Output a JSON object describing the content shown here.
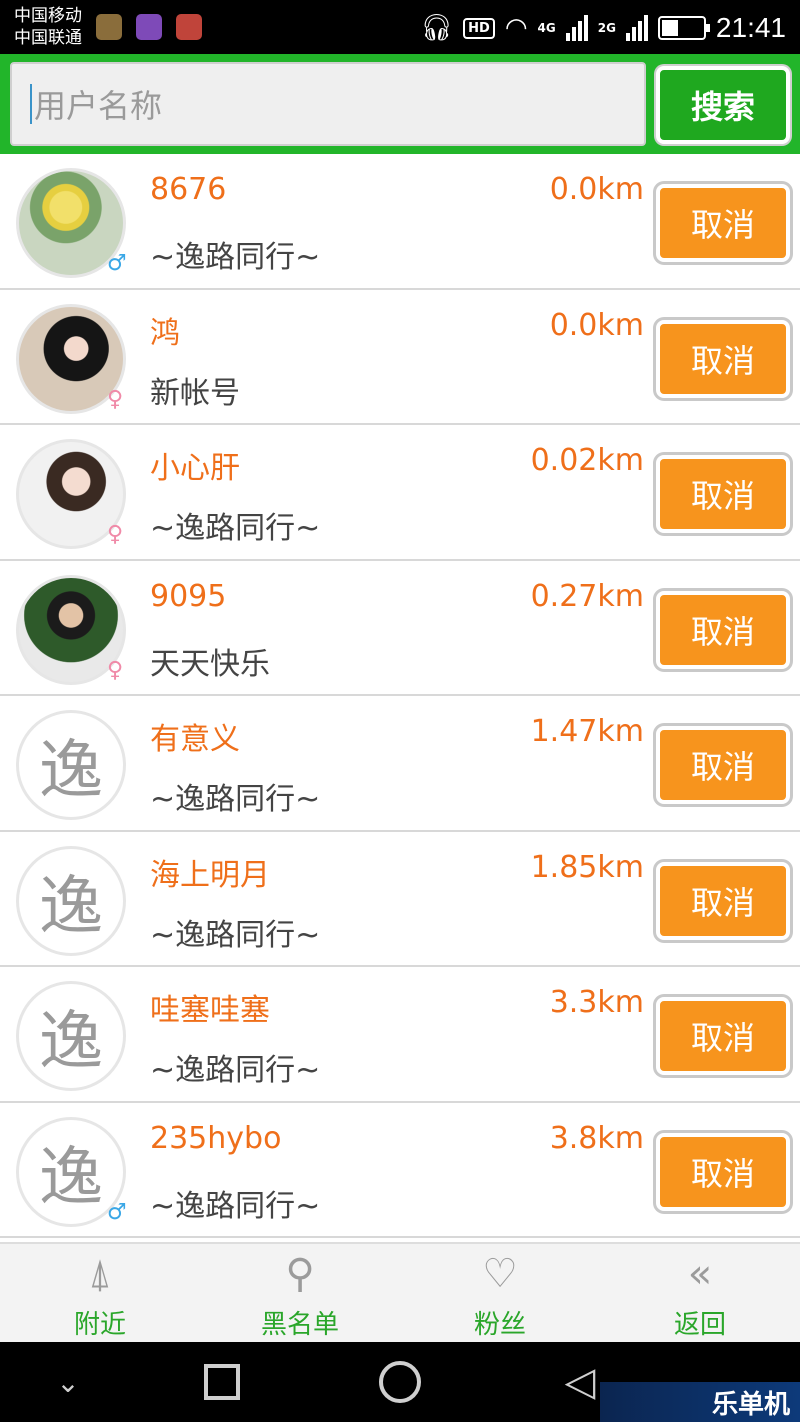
{
  "status_bar": {
    "carrier1": "中国移动",
    "carrier2": "中国联通",
    "hd": "HD",
    "net1": "4G",
    "net2": "2G",
    "time": "21:41",
    "battery_level": 0.4
  },
  "search": {
    "placeholder": "用户名称",
    "button_label": "搜索"
  },
  "users": [
    {
      "name": "8676",
      "signature": "~逸路同行~",
      "distance": "0.0km",
      "gender": "♂",
      "gender_type": "male",
      "avatar": "photo1",
      "avatar_glyph": "",
      "action": "取消"
    },
    {
      "name": "鸿",
      "signature": "新帐号",
      "distance": "0.0km",
      "gender": "♀",
      "gender_type": "female",
      "avatar": "photo2",
      "avatar_glyph": "",
      "action": "取消"
    },
    {
      "name": "小心肝",
      "signature": "~逸路同行~",
      "distance": "0.02km",
      "gender": "♀",
      "gender_type": "female",
      "avatar": "photo3",
      "avatar_glyph": "",
      "action": "取消"
    },
    {
      "name": "9095",
      "signature": "天天快乐",
      "distance": "0.27km",
      "gender": "♀",
      "gender_type": "female",
      "avatar": "photo4",
      "avatar_glyph": "",
      "action": "取消"
    },
    {
      "name": "有意义",
      "signature": "~逸路同行~",
      "distance": "1.47km",
      "gender": "",
      "gender_type": "none",
      "avatar": "default",
      "avatar_glyph": "逸",
      "action": "取消"
    },
    {
      "name": "海上明月",
      "signature": "~逸路同行~",
      "distance": "1.85km",
      "gender": "",
      "gender_type": "none",
      "avatar": "default",
      "avatar_glyph": "逸",
      "action": "取消"
    },
    {
      "name": "哇塞哇塞",
      "signature": "~逸路同行~",
      "distance": "3.3km",
      "gender": "",
      "gender_type": "none",
      "avatar": "default",
      "avatar_glyph": "逸",
      "action": "取消"
    },
    {
      "name": "235hybo",
      "signature": "~逸路同行~",
      "distance": "3.8km",
      "gender": "♂",
      "gender_type": "male",
      "avatar": "default",
      "avatar_glyph": "逸",
      "action": "取消"
    }
  ],
  "tabs": [
    {
      "label": "附近",
      "icon": "antenna-icon",
      "glyph": "⍋"
    },
    {
      "label": "黑名单",
      "icon": "user-block-icon",
      "glyph": "⚲"
    },
    {
      "label": "粉丝",
      "icon": "user-heart-icon",
      "glyph": "♡"
    },
    {
      "label": "返回",
      "icon": "double-chevron-left-icon",
      "glyph": "«"
    }
  ],
  "navbar": {
    "down": "⌄",
    "back": "◁",
    "watermark": "乐单机"
  },
  "colors": {
    "header_green": "#22b52a",
    "accent_orange": "#f7941d",
    "name_orange": "#ef6f1a",
    "tab_green": "#2aa62a"
  }
}
